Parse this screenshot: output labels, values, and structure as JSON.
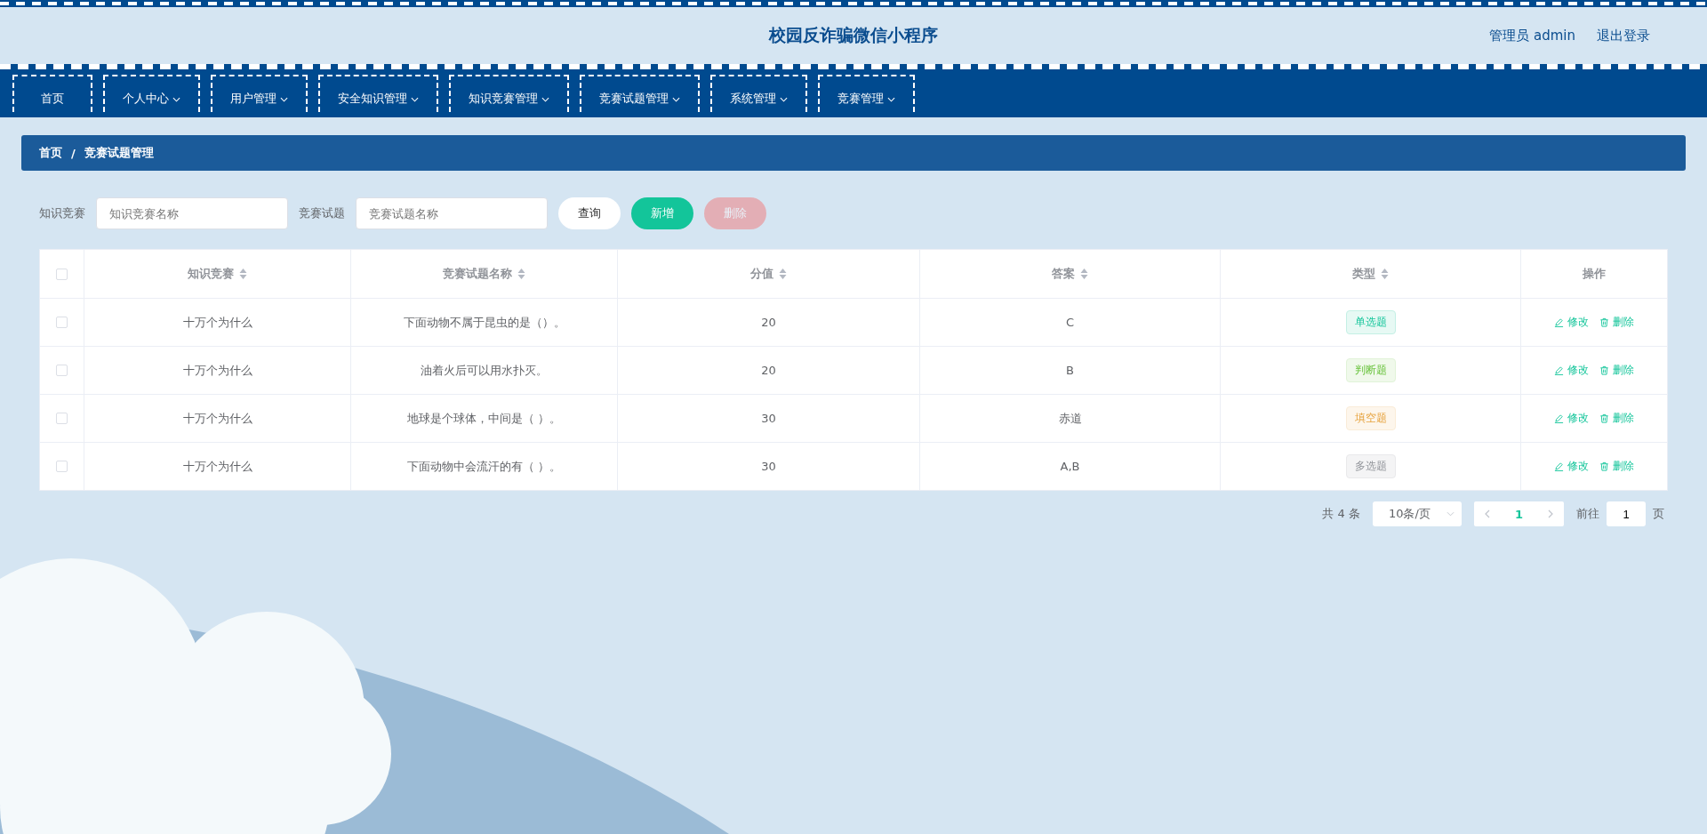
{
  "header": {
    "title": "校园反诈骗微信小程序",
    "user": "管理员 admin",
    "logout": "退出登录"
  },
  "nav": [
    {
      "label": "首页",
      "dropdown": false
    },
    {
      "label": "个人中心",
      "dropdown": true
    },
    {
      "label": "用户管理",
      "dropdown": true
    },
    {
      "label": "安全知识管理",
      "dropdown": true
    },
    {
      "label": "知识竞赛管理",
      "dropdown": true
    },
    {
      "label": "竞赛试题管理",
      "dropdown": true
    },
    {
      "label": "系统管理",
      "dropdown": true
    },
    {
      "label": "竞赛管理",
      "dropdown": true
    }
  ],
  "breadcrumb": {
    "items": [
      "首页",
      "竞赛试题管理"
    ],
    "separator": "/"
  },
  "filters": [
    {
      "label": "知识竞赛",
      "placeholder": "知识竞赛名称"
    },
    {
      "label": "竞赛试题",
      "placeholder": "竞赛试题名称"
    }
  ],
  "buttons": [
    {
      "label": "查询",
      "kind": "plain",
      "disabled": false
    },
    {
      "label": "新增",
      "kind": "primary",
      "disabled": false
    },
    {
      "label": "删除",
      "kind": "danger",
      "disabled": true
    }
  ],
  "table": {
    "select_all_checked": false,
    "columns": [
      {
        "label": "知识竞赛",
        "sortable": true
      },
      {
        "label": "竞赛试题名称",
        "sortable": true
      },
      {
        "label": "分值",
        "sortable": true
      },
      {
        "label": "答案",
        "sortable": true
      },
      {
        "label": "类型",
        "sortable": true
      },
      {
        "label": "操作",
        "sortable": false
      }
    ],
    "rows": [
      {
        "checked": false,
        "contest": "十万个为什么",
        "question": "下面动物不属于昆虫的是（）。",
        "score": "20",
        "answer": "C",
        "type": {
          "label": "单选题",
          "kind": "single"
        },
        "actions": [
          "修改",
          "删除"
        ]
      },
      {
        "checked": false,
        "contest": "十万个为什么",
        "question": "油着火后可以用水扑灭。",
        "score": "20",
        "answer": "B",
        "type": {
          "label": "判断题",
          "kind": "judge"
        },
        "actions": [
          "修改",
          "删除"
        ]
      },
      {
        "checked": false,
        "contest": "十万个为什么",
        "question": "地球是个球体，中间是（ ）。",
        "score": "30",
        "answer": "赤道",
        "type": {
          "label": "填空题",
          "kind": "fill"
        },
        "actions": [
          "修改",
          "删除"
        ]
      },
      {
        "checked": false,
        "contest": "十万个为什么",
        "question": "下面动物中会流汗的有（ ）。",
        "score": "30",
        "answer": "A,B",
        "type": {
          "label": "多选题",
          "kind": "multi"
        },
        "actions": [
          "修改",
          "删除"
        ]
      }
    ]
  },
  "pagination": {
    "total": "共 4 条",
    "page_size": "10条/页",
    "current_page": "1",
    "goto_label": "前往",
    "goto_value": "1",
    "goto_suffix": "页"
  }
}
